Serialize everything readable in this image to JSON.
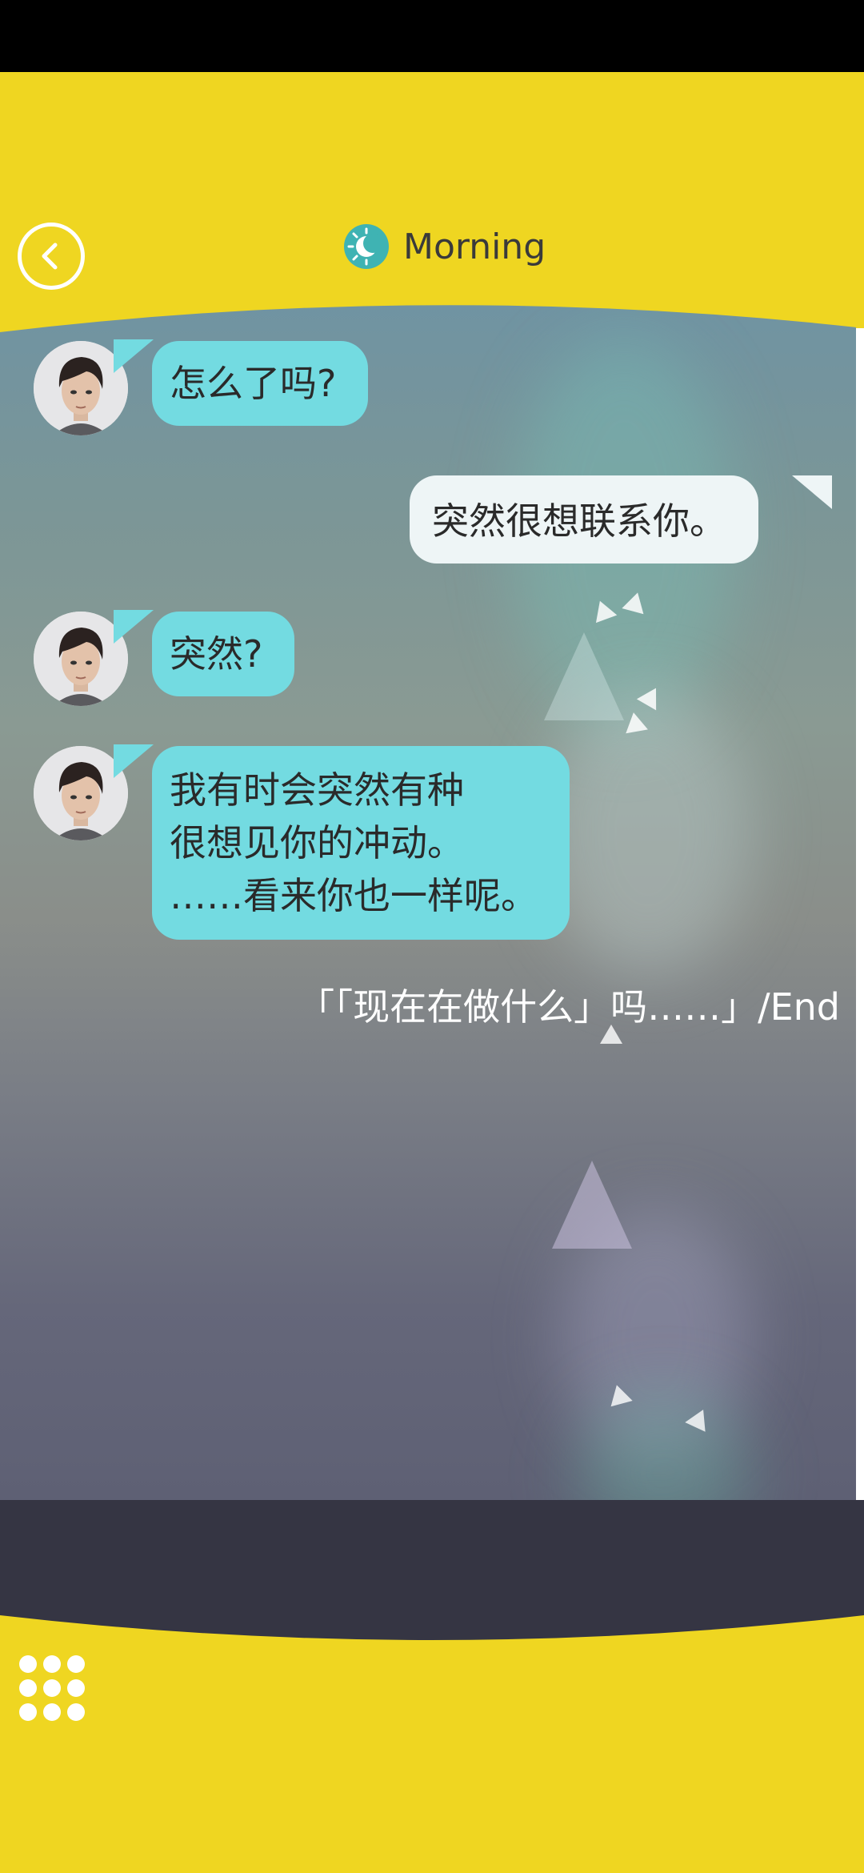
{
  "header": {
    "title": "Morning",
    "back_icon": "chevron-left-icon",
    "title_icon": "sun-icon"
  },
  "colors": {
    "accent_yellow": "#efd621",
    "bubble_incoming": "#73dbe1",
    "bubble_outgoing": "#eef5f6",
    "footer_dark": "#353543",
    "title_icon": "#3fb3b3"
  },
  "messages": [
    {
      "side": "left",
      "lines": [
        "怎么了吗?"
      ]
    },
    {
      "side": "right",
      "lines": [
        "突然很想联系你。"
      ]
    },
    {
      "side": "left",
      "lines": [
        "突然?"
      ]
    },
    {
      "side": "left",
      "lines": [
        "我有时会突然有种",
        "很想见你的冲动。",
        "……看来你也一样呢。"
      ]
    }
  ],
  "narration": "「「现在在做什么」吗……」/End",
  "footer": {
    "menu_icon": "grid-menu-icon"
  }
}
